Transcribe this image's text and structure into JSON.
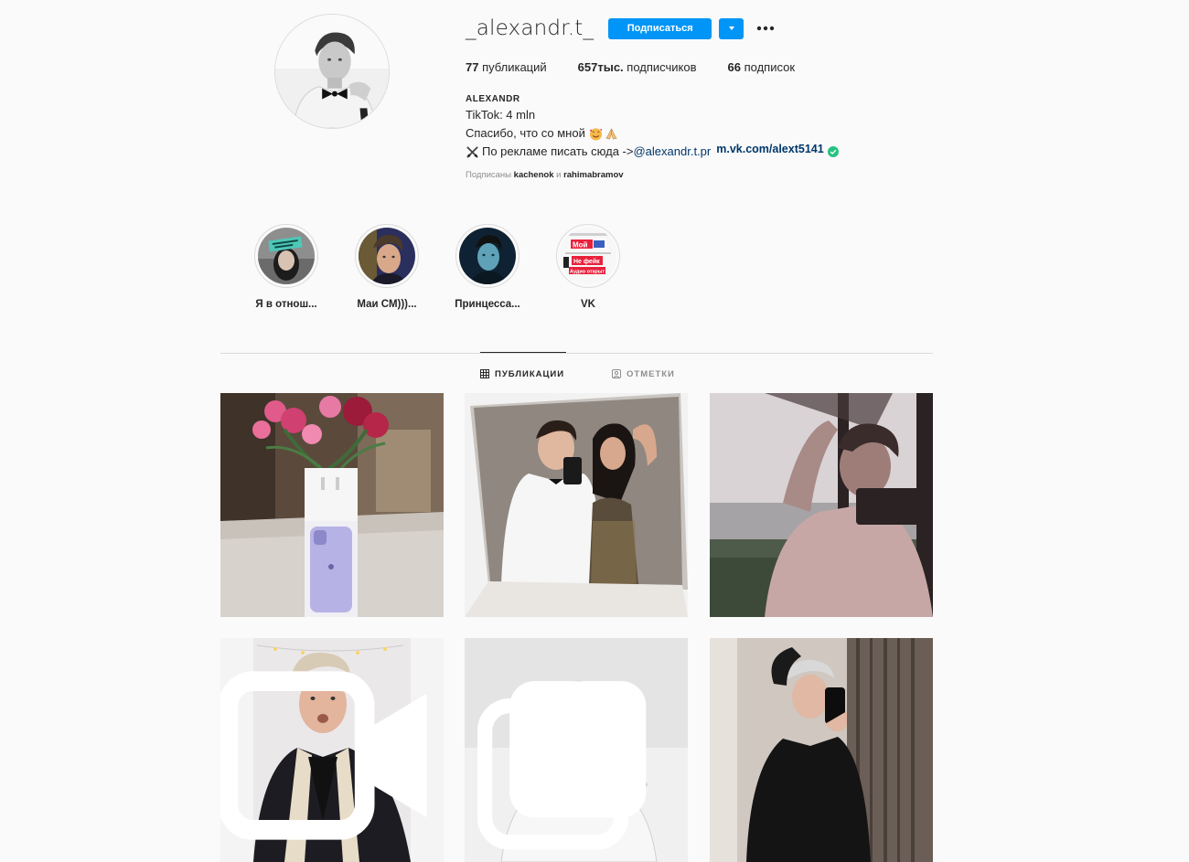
{
  "profile": {
    "username": "_alexandr.t_",
    "follow_label": "Подписаться",
    "stats": {
      "posts_count": "77",
      "posts_label": " публикаций",
      "followers_count": "657тыс.",
      "followers_label": " подписчиков",
      "following_count": "66",
      "following_label": " подписок"
    },
    "bio": {
      "name": "ALEXANDR",
      "line1": "TikTok: 4 mln",
      "line2": "Спасибо, что со мной",
      "line3_text": "По рекламе писать сюда -> ",
      "line3_mention": "@alexandr.t.pr",
      "line3_link": "m.vk.com/alext5141",
      "emojis": [
        "smiling-face-with-hearts-icon",
        "folded-hands-icon",
        "crossed-swords-icon"
      ]
    },
    "followed_by_prefix": "Подписаны ",
    "followed_by_user1": "kachenok",
    "followed_by_and": " и ",
    "followed_by_user2": "rahimabramov"
  },
  "highlights": [
    {
      "label": "Я в отнош..."
    },
    {
      "label": "Маи СМ)))..."
    },
    {
      "label": "Принцесса..."
    },
    {
      "label": "VK",
      "stickers": [
        "Мой",
        "Не фейк",
        "Аудио открыт"
      ]
    }
  ],
  "tabs": {
    "posts": "ПУБЛИКАЦИИ",
    "tagged": "ОТМЕТКИ"
  },
  "posts": [
    {
      "alt": "flowers-airpods-iphone"
    },
    {
      "alt": "couple-mirror-selfie"
    },
    {
      "alt": "window-silhouette"
    },
    {
      "alt": "jacket-portrait",
      "badge": "video-icon"
    },
    {
      "alt": "bw-bowtie-portrait",
      "badge": "carousel-icon"
    },
    {
      "alt": "black-sweater-mirror-selfie"
    }
  ],
  "colors": {
    "accent": "#0095f6",
    "text": "#262626",
    "muted": "#8e8e8e",
    "link": "#00376b",
    "background": "#fafafa",
    "border": "#dbdbdb"
  }
}
